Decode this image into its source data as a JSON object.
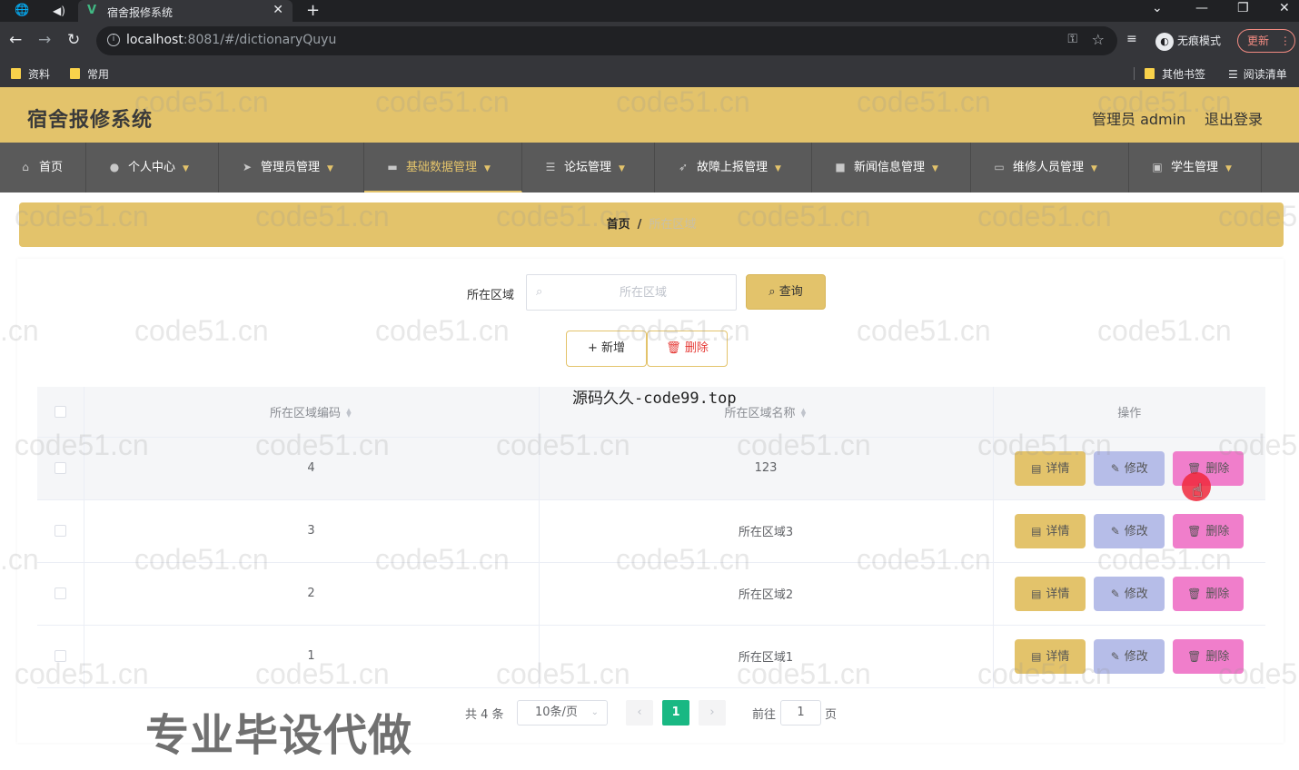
{
  "browser": {
    "tab_title": "宿舍报修系统",
    "url_host": "localhost",
    "url_path": ":8081/#/dictionaryQuyu",
    "incognito_label": "无痕模式",
    "update_label": "更新",
    "bookmarks": [
      "资料",
      "常用"
    ],
    "bookmarks_right": [
      "其他书签",
      "阅读清单"
    ]
  },
  "header": {
    "title": "宿舍报修系统",
    "admin_label": "管理员 admin",
    "logout_label": "退出登录"
  },
  "menu": [
    {
      "label": "首页",
      "icon": "home-icon"
    },
    {
      "label": "个人中心",
      "icon": "user-icon"
    },
    {
      "label": "管理员管理",
      "icon": "send-icon"
    },
    {
      "label": "基础数据管理",
      "icon": "monitor-icon",
      "active": true
    },
    {
      "label": "论坛管理",
      "icon": "sliders-icon"
    },
    {
      "label": "故障上报管理",
      "icon": "navigation-icon"
    },
    {
      "label": "新闻信息管理",
      "icon": "camera-icon"
    },
    {
      "label": "维修人员管理",
      "icon": "laptop-icon"
    },
    {
      "label": "学生管理",
      "icon": "chat-icon"
    }
  ],
  "breadcrumb": {
    "home": "首页",
    "separator": "/",
    "current": "所在区域"
  },
  "search": {
    "label": "所在区域",
    "placeholder": "所在区域",
    "query_button": "查询"
  },
  "actions": {
    "add_button": "新增",
    "delete_button": "删除"
  },
  "table": {
    "columns": [
      "所在区域编码",
      "所在区域名称",
      "操作"
    ],
    "rows": [
      {
        "code": "4",
        "name": "123"
      },
      {
        "code": "3",
        "name": "所在区域3"
      },
      {
        "code": "2",
        "name": "所在区域2"
      },
      {
        "code": "1",
        "name": "所在区域1"
      }
    ],
    "row_buttons": {
      "detail": "详情",
      "edit": "修改",
      "delete": "删除"
    }
  },
  "pagination": {
    "total_text": "共 4 条",
    "page_size": "10条/页",
    "current_page": "1",
    "goto_label": "前往",
    "goto_value": "1",
    "page_unit": "页"
  },
  "overlays": {
    "watermark": "code51.cn",
    "watermark_edge": ".cn",
    "watermark_clip": "code5",
    "source_text": "源码久久-code99.top",
    "promo_text": "专业毕设代做"
  }
}
